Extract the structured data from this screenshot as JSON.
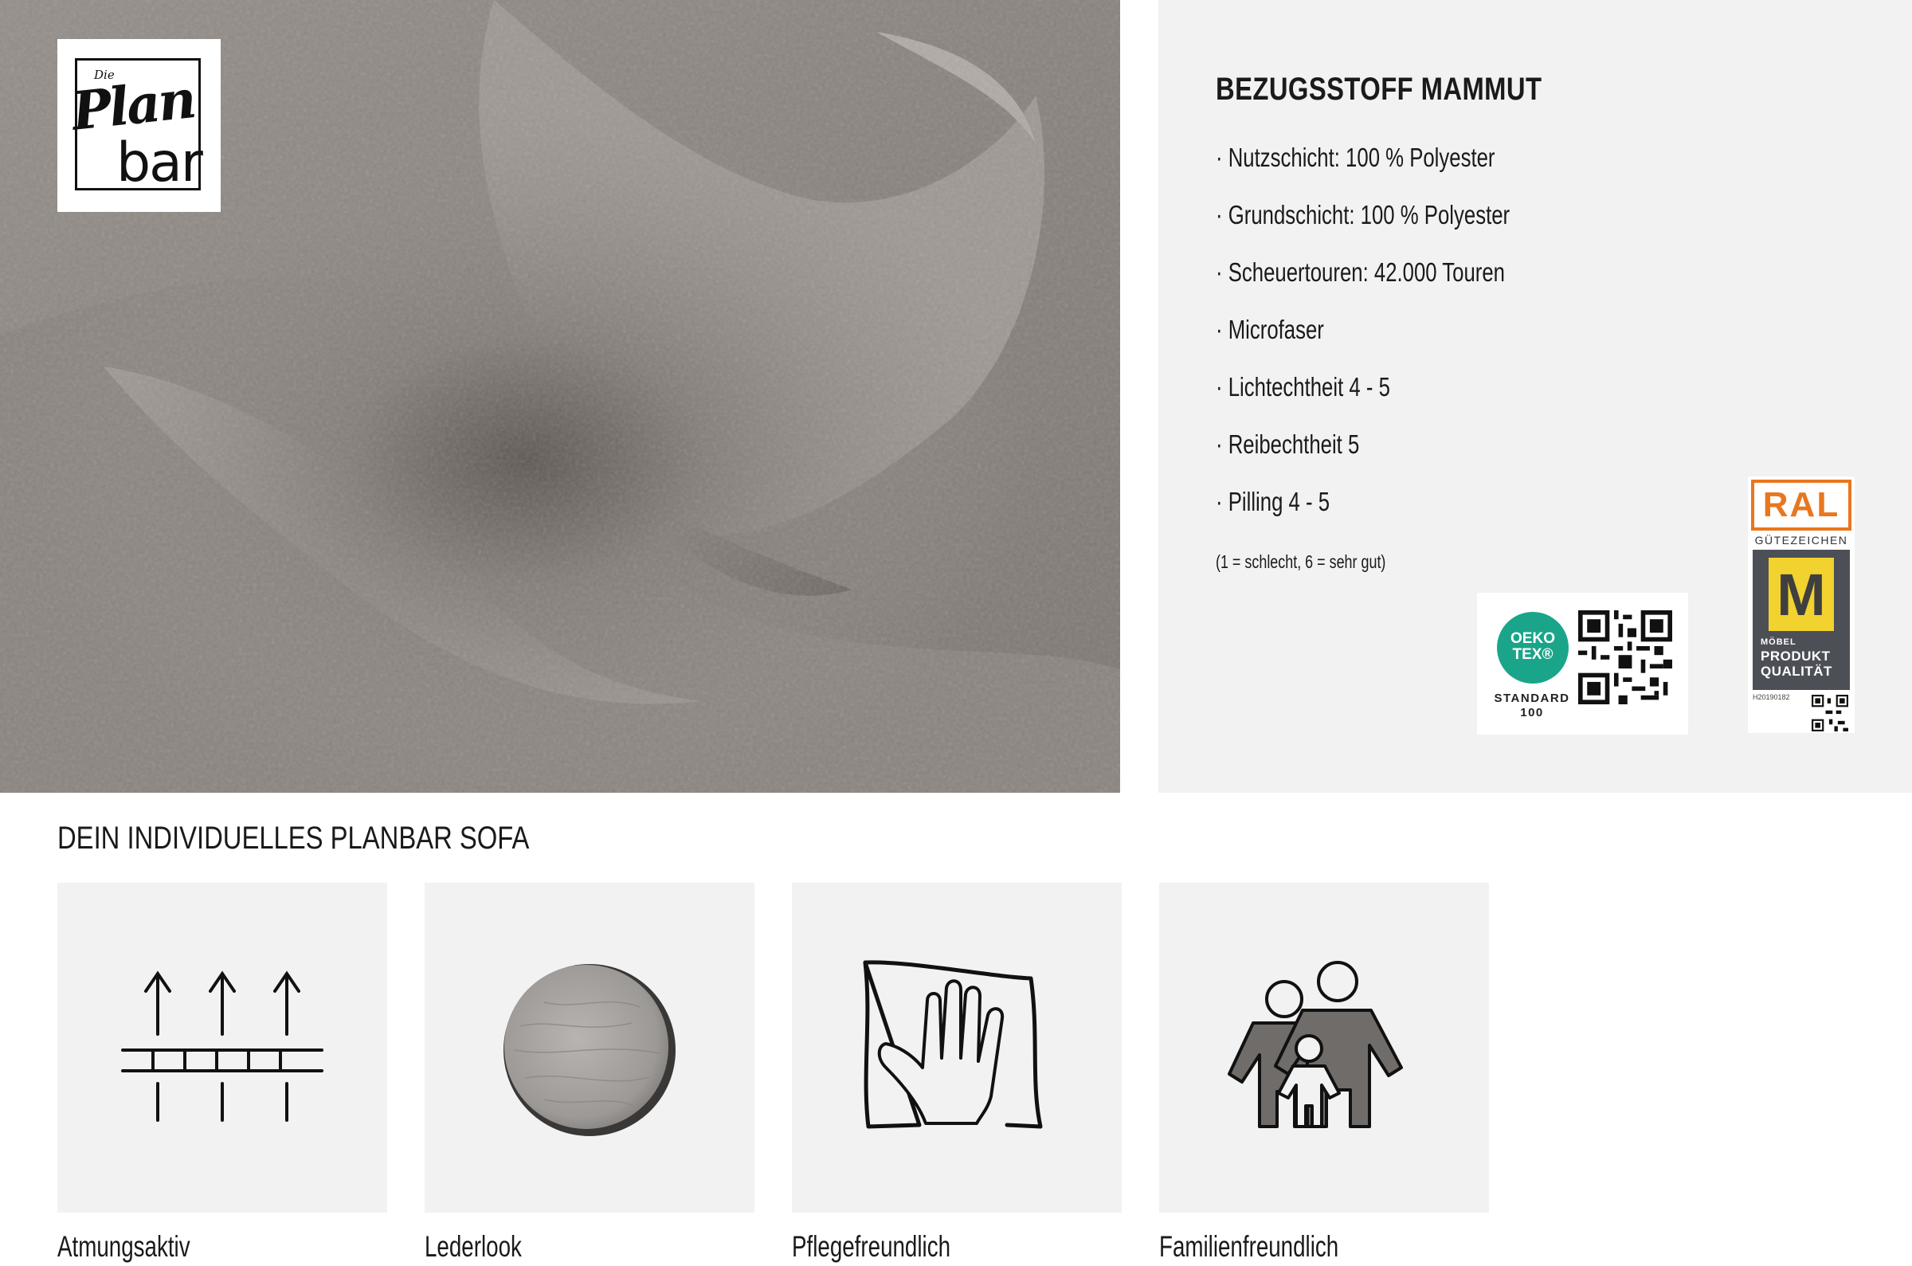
{
  "brand": {
    "small": "Die",
    "word1": "Plan",
    "word2": "bar"
  },
  "spec": {
    "title": "BEZUGSSTOFF MAMMUT",
    "items": [
      "· Nutzschicht: 100 % Polyester",
      "· Grundschicht: 100 % Polyester",
      "· Scheuertouren: 42.000 Touren",
      "· Microfaser",
      "· Lichtechtheit 4 - 5",
      "· Reibechtheit 5",
      "· Pilling 4 - 5"
    ],
    "note": "(1 = schlecht, 6 = sehr gut)"
  },
  "badges": {
    "oeko": {
      "line1": "OEKO",
      "line2": "TEX®",
      "std1": "STANDARD",
      "std2": "100"
    },
    "ral": {
      "top": "RAL",
      "guete": "GÜTEZEICHEN",
      "mark": "M",
      "small": "MÖBEL",
      "line1": "PRODUKT",
      "line2": "QUALITÄT",
      "number": "H20190182"
    }
  },
  "section": {
    "title": "DEIN INDIVIDUELLES PLANBAR SOFA",
    "features": [
      {
        "label": "Atmungsaktiv",
        "icon": "breathable-arrows-icon"
      },
      {
        "label": "Lederlook",
        "icon": "leather-disc-icon"
      },
      {
        "label": "Pflegefreundlich",
        "icon": "hand-cloth-icon"
      },
      {
        "label": "Familienfreundlich",
        "icon": "family-icon"
      }
    ]
  },
  "colors": {
    "fabric": "#8f8984",
    "panel": "#f2f2f2",
    "oeko_green": "#1aa58a",
    "ral_orange": "#e8771f",
    "ral_yellow": "#f2d22f",
    "ral_dark": "#4c4f56"
  }
}
